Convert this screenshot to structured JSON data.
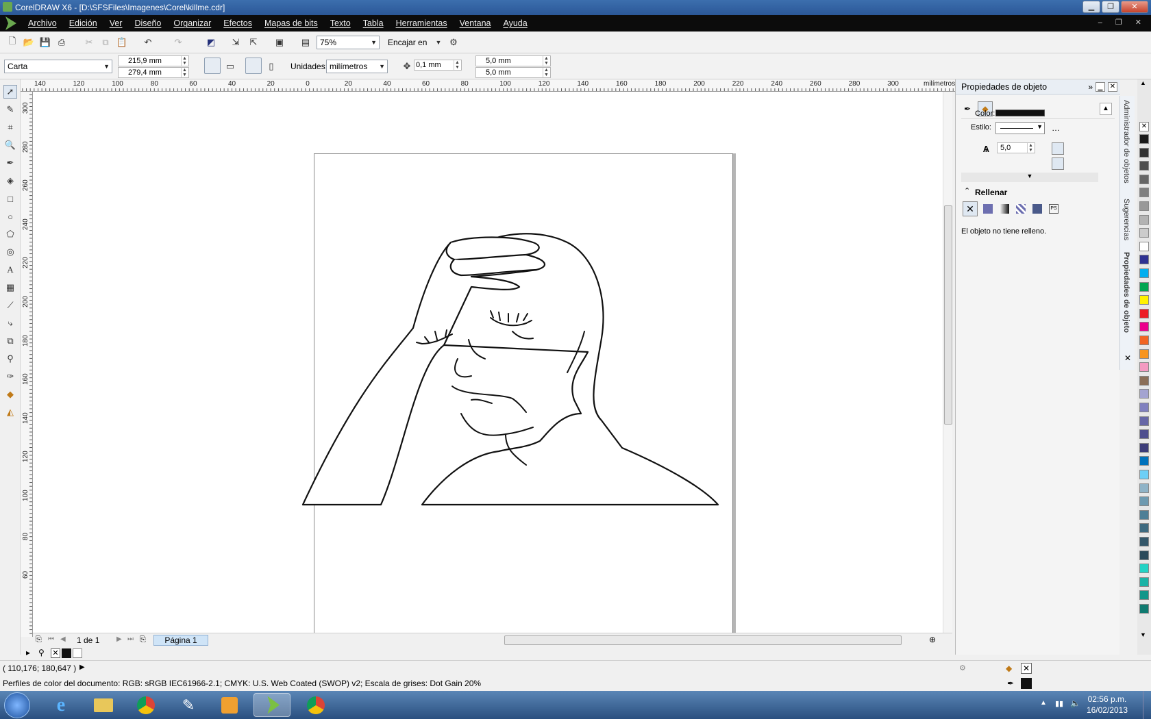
{
  "window": {
    "title": "CorelDRAW X6 - [D:\\SFSFiles\\Imagenes\\Corel\\killme.cdr]"
  },
  "menu": [
    "Archivo",
    "Edición",
    "Ver",
    "Diseño",
    "Organizar",
    "Efectos",
    "Mapas de bits",
    "Texto",
    "Tabla",
    "Herramientas",
    "Ventana",
    "Ayuda"
  ],
  "toolbar": {
    "zoom_value": "75%",
    "snap_label": "Encajar en"
  },
  "propertybar": {
    "paper_size": "Carta",
    "width": "215,9 mm",
    "height": "279,4 mm",
    "units_label": "Unidades:",
    "units_value": "milímetros",
    "nudge": "0,1 mm",
    "dup_x": "5,0 mm",
    "dup_y": "5,0 mm"
  },
  "rulers": {
    "units": "milímetros",
    "h_ticks": [
      "140",
      "120",
      "100",
      "80",
      "60",
      "40",
      "20",
      "0",
      "20",
      "40",
      "60",
      "80",
      "100",
      "120",
      "140",
      "160",
      "180",
      "200",
      "220",
      "240",
      "260",
      "280",
      "300"
    ],
    "v_ticks": [
      "300",
      "280",
      "260",
      "240",
      "220",
      "200",
      "180",
      "160",
      "140",
      "120",
      "100",
      "80",
      "60"
    ]
  },
  "page_nav": {
    "counter": "1 de 1",
    "page_tab": "Página 1"
  },
  "status": {
    "coords": "( 110,176; 180,647 )",
    "color_profiles": "Perfiles de color del documento: RGB: sRGB IEC61966-2.1; CMYK: U.S. Web Coated (SWOP) v2; Escala de grises: Dot Gain 20%"
  },
  "docker": {
    "title": "Propiedades de objeto",
    "color_label": "Color:",
    "style_label": "Estilo:",
    "width_value": "5,0",
    "fill_section": "Rellenar",
    "no_fill_message": "El objeto no tiene relleno.",
    "side_tabs": [
      "Administrador de objetos",
      "Sugerencias",
      "Propiedades de objeto"
    ]
  },
  "palette_colors": [
    "#1a1a1a",
    "#333333",
    "#4d4d4d",
    "#666666",
    "#808080",
    "#999999",
    "#b3b3b3",
    "#cccccc",
    "#ffffff",
    "#2e3192",
    "#00aeef",
    "#00a651",
    "#fff200",
    "#ed1c24",
    "#ec008c",
    "#f26522",
    "#f7941d",
    "#f49ac1",
    "#8b6e56",
    "#a3a3d1",
    "#7f7fbf",
    "#6666a6",
    "#4f4f8f",
    "#3b3b78",
    "#0072bc",
    "#6dcff6",
    "#8fb3c7",
    "#6e9ab0",
    "#4f7f96",
    "#3d6a80",
    "#33576a",
    "#2b4a5a",
    "#22d3c5",
    "#1ab3a6",
    "#12968a",
    "#0f7a70"
  ],
  "taskbar": {
    "time": "02:56 p.m.",
    "date": "16/02/2013"
  }
}
